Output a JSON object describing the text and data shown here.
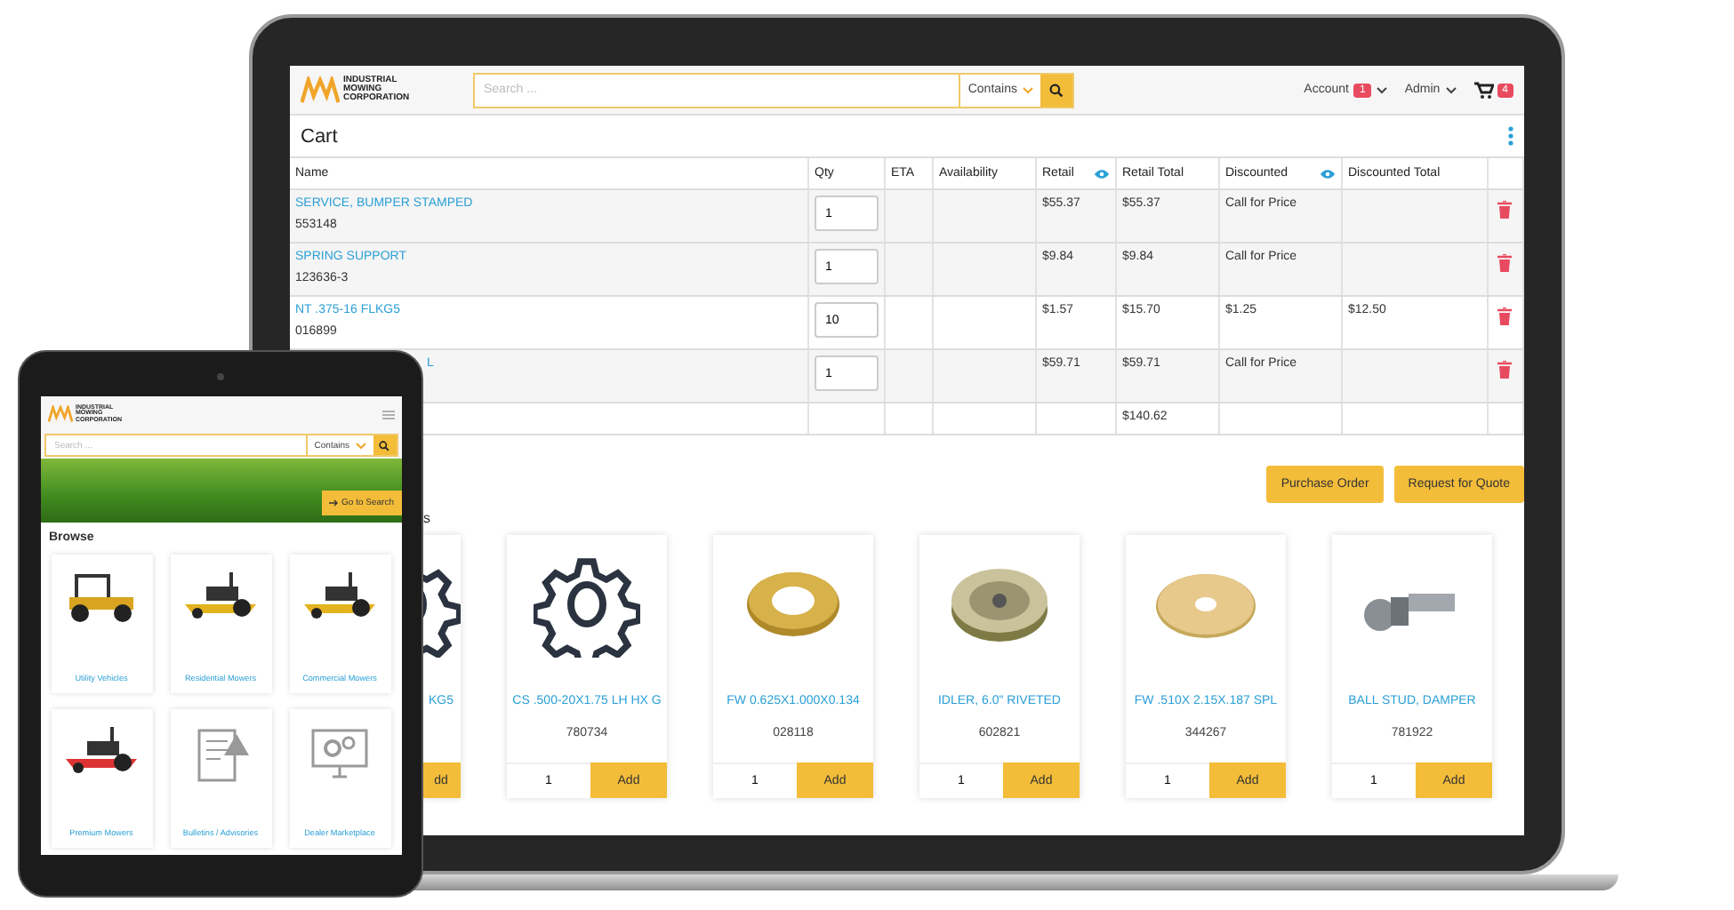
{
  "laptop": {
    "header": {
      "logo": [
        "INDUSTRIAL",
        "MOWING",
        "CORPORATION"
      ],
      "search": {
        "placeholder": "Search ...",
        "scope": "Contains"
      },
      "account": {
        "label": "Account",
        "badge": "1"
      },
      "admin": {
        "label": "Admin"
      },
      "cart": {
        "badge": "4"
      }
    },
    "cart": {
      "title": "Cart",
      "columns": [
        {
          "label": "Name"
        },
        {
          "label": "Qty"
        },
        {
          "label": "ETA"
        },
        {
          "label": "Availability"
        },
        {
          "label": "Retail",
          "kind": "eye"
        },
        {
          "label": "Retail Total"
        },
        {
          "label": "Discounted",
          "kind": "eye"
        },
        {
          "label": "Discounted Total"
        }
      ],
      "rows": [
        {
          "name": "SERVICE, BUMPER STAMPED",
          "part": "553148",
          "qty": "1",
          "retail": "$55.37",
          "retail_total": "$55.37",
          "discounted": "Call for Price"
        },
        {
          "name": "SPRING SUPPORT",
          "part": "123636-3",
          "qty": "1",
          "retail": "$9.84",
          "retail_total": "$9.84",
          "discounted": "Call for Price"
        },
        {
          "name": "NT .375-16 FLKG5",
          "part": "016899",
          "qty": "10",
          "retail": "$1.57",
          "retail_total": "$15.70",
          "discounted": "$1.25",
          "discounted_total": "$12.50"
        },
        {
          "name": "L",
          "covered": true,
          "qty": "1",
          "retail": "$59.71",
          "retail_total": "$59.71",
          "discounted": "Call for Price"
        }
      ],
      "total": "$140.62"
    },
    "actions": [
      "Purchase Order",
      "Request for Quote"
    ],
    "section_heading": {
      "text": "s",
      "covered": true
    },
    "products": [
      {
        "name": "KG5",
        "covered": true,
        "kind": "gear",
        "add": "dd"
      },
      {
        "name": "CS .500-20X1.75 LH HX G",
        "number": "780734",
        "kind": "gear",
        "qty": "1",
        "add": "Add"
      },
      {
        "name": "FW 0.625X1.000X0.134",
        "number": "028118",
        "kind": "thick-washer",
        "qty": "1",
        "add": "Add"
      },
      {
        "name": "IDLER, 6.0\" RIVETED",
        "number": "602821",
        "kind": "pulley",
        "qty": "1",
        "add": "Add"
      },
      {
        "name": "FW .510X 2.15X.187 SPL",
        "number": "344267",
        "kind": "flat-washer",
        "qty": "1",
        "add": "Add"
      },
      {
        "name": "BALL STUD, DAMPER",
        "number": "781922",
        "kind": "ball-stud",
        "qty": "1",
        "add": "Add"
      }
    ]
  },
  "tablet": {
    "logo": [
      "INDUSTRIAL",
      "MOWING",
      "CORPORATION"
    ],
    "search": {
      "placeholder": "Search ...",
      "scope": "Contains"
    },
    "hero_button": "Go to Search",
    "heading": "Browse",
    "tiles": [
      {
        "label": "Utility Vehicles",
        "kind": "utility-vehicle"
      },
      {
        "label": "Residential Mowers",
        "kind": "riding-mower"
      },
      {
        "label": "Commercial Mowers",
        "kind": "stand-on-mower"
      },
      {
        "label": "Premium Mowers",
        "kind": "red-mower"
      },
      {
        "label": "Bulletins / Advisories",
        "kind": "bulletin"
      },
      {
        "label": "Dealer Marketplace",
        "kind": "monitor-gears"
      }
    ]
  }
}
